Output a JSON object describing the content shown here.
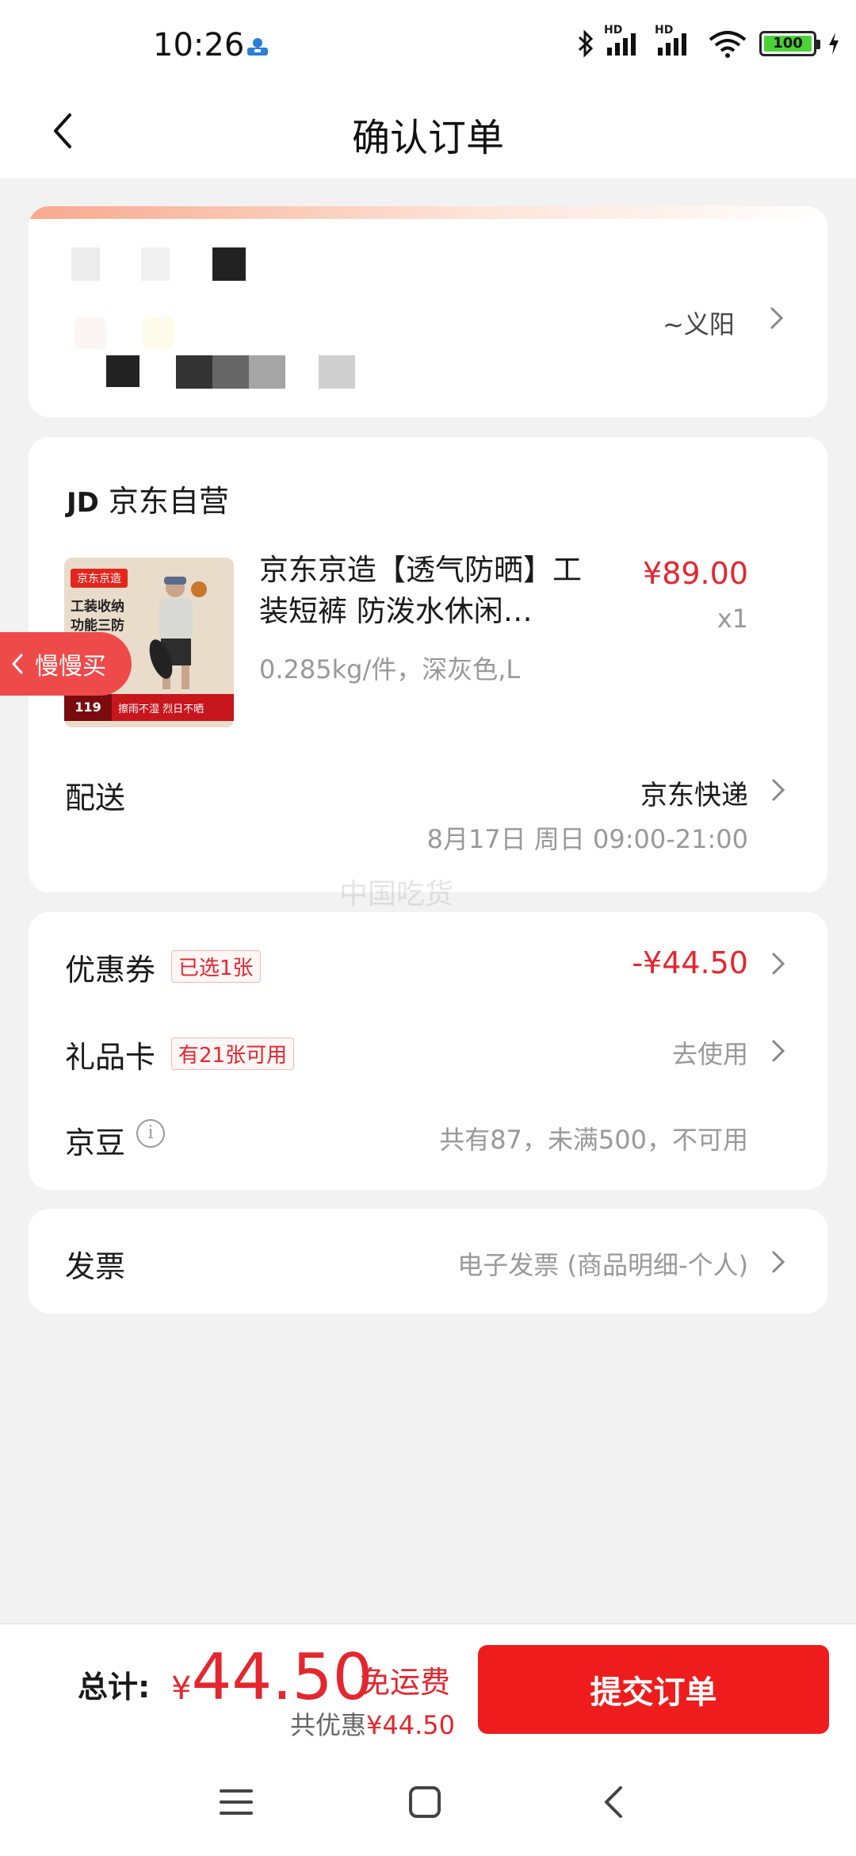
{
  "status_bar": {
    "time": "10:26",
    "battery": "100",
    "hd_label": "HD"
  },
  "header": {
    "title": "确认订单"
  },
  "address": {
    "tail_text": "~义阳"
  },
  "shop": {
    "logo_text": "JD",
    "name": "京东自营"
  },
  "product": {
    "thumb_tag": "京东京造",
    "thumb_line1": "工装收纳",
    "thumb_line2": "功能三防",
    "thumb_price": "119",
    "thumb_slogan": "擦雨不湿 烈日不晒",
    "title": "京东京造【透气防晒】工装短裤 防泼水休闲…",
    "price": "¥89.00",
    "quantity": "x1",
    "spec": "0.285kg/件，深灰色,L"
  },
  "shipping": {
    "label": "配送",
    "method": "京东快递",
    "time": "8月17日 周日 09:00-21:00"
  },
  "slow_buy": {
    "label": "慢慢买"
  },
  "watermark": "中国吃货",
  "discounts": {
    "coupon_label": "优惠券",
    "coupon_tag": "已选1张",
    "coupon_value": "-¥44.50",
    "giftcard_label": "礼品卡",
    "giftcard_tag": "有21张可用",
    "giftcard_value": "去使用",
    "jingdou_label": "京豆",
    "jingdou_info_icon": "i",
    "jingdou_value": "共有87，未满500，不可用"
  },
  "invoice": {
    "label": "发票",
    "value": "电子发票 (商品明细-个人)"
  },
  "footer": {
    "total_label": "总计:",
    "currency": "¥",
    "total_amount": "44.50",
    "free_shipping": "免运费",
    "saved_prefix": "共优惠",
    "saved_amount": "¥44.50",
    "submit_label": "提交订单"
  },
  "colors": {
    "accent_red": "#e4262e",
    "button_red": "#ee1c1c",
    "background": "#f2f2f2"
  },
  "icons": [
    "back-arrow-icon",
    "chevron-right-icon",
    "bluetooth-icon",
    "signal-icon",
    "wifi-icon",
    "battery-icon",
    "charging-icon",
    "info-icon",
    "menu-icon",
    "home-square-icon",
    "nav-back-icon"
  ]
}
